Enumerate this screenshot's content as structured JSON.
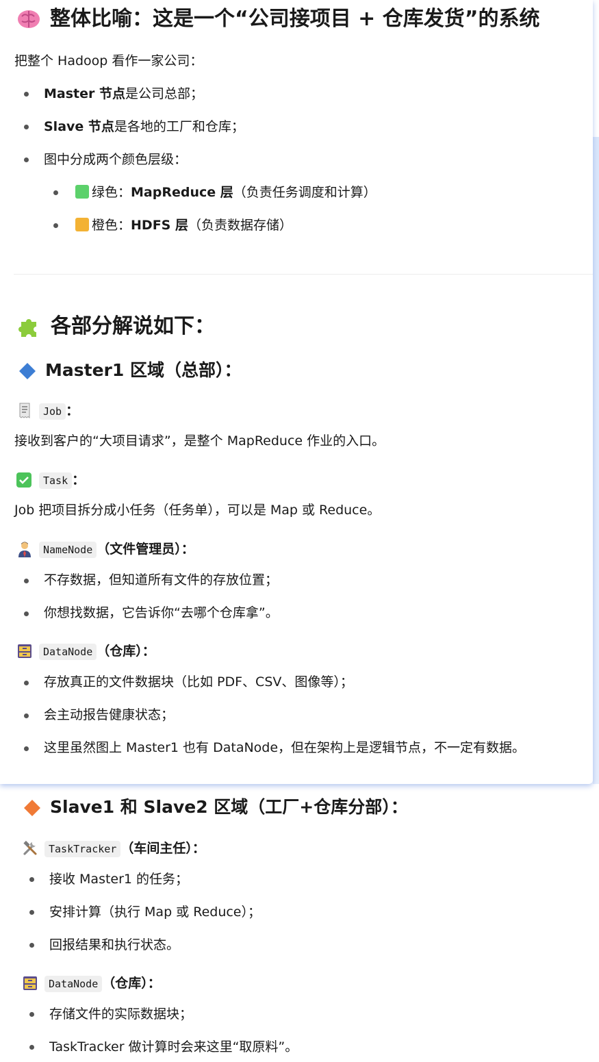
{
  "section1": {
    "title": "整体比喻：这是一个“公司接项目 + 仓库发货”的系统",
    "intro": "把整个 Hadoop 看作一家公司：",
    "items": [
      {
        "bold": "Master 节点",
        "text": "是公司总部；"
      },
      {
        "bold": "Slave 节点",
        "text": "是各地的工厂和仓库；"
      },
      {
        "bold": "",
        "text": "图中分成两个颜色层级："
      }
    ],
    "layers": [
      {
        "color": "#5cd16b",
        "prefix": "绿色：",
        "bold": "MapReduce 层",
        "text": "（负责任务调度和计算）"
      },
      {
        "color": "#f3b234",
        "prefix": "橙色：",
        "bold": "HDFS 层",
        "text": "（负责数据存储）"
      }
    ]
  },
  "section2": {
    "title": "各部分解说如下：",
    "master": {
      "title": "Master1 区域（总部）：",
      "job": {
        "code": "Job",
        "suffix": "：",
        "desc": "接收到客户的“大项目请求”，是整个 MapReduce 作业的入口。"
      },
      "task": {
        "code": "Task",
        "suffix": "：",
        "desc": "Job 把项目拆分成小任务（任务单），可以是 Map 或 Reduce。"
      },
      "namenode": {
        "code": "NameNode",
        "suffix": "（文件管理员）：",
        "items": [
          "不存数据，但知道所有文件的存放位置；",
          "你想找数据，它告诉你“去哪个仓库拿”。"
        ]
      },
      "datanode": {
        "code": "DataNode",
        "suffix": "（仓库）：",
        "items": [
          "存放真正的文件数据块（比如 PDF、CSV、图像等）；",
          "会主动报告健康状态；",
          "这里虽然图上 Master1 也有 DataNode，但在架构上是逻辑节点，不一定有数据。"
        ]
      }
    },
    "slave": {
      "title": "Slave1 和 Slave2 区域（工厂+仓库分部）：",
      "tasktracker": {
        "code": "TaskTracker",
        "suffix": "（车间主任）：",
        "items": [
          "接收 Master1 的任务；",
          "安排计算（执行 Map 或 Reduce）；",
          "回报结果和执行状态。"
        ]
      },
      "datanode": {
        "code": "DataNode",
        "suffix": "（仓库）：",
        "items": [
          "存储文件的实际数据块；",
          "TaskTracker 做计算时会来这里“取原料”。"
        ]
      }
    }
  }
}
